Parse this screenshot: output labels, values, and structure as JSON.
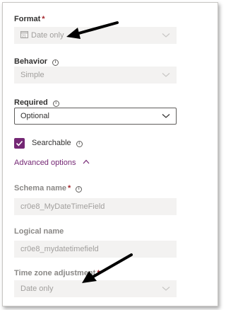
{
  "format": {
    "label": "Format",
    "required_mark": "*",
    "value": "Date only"
  },
  "behavior": {
    "label": "Behavior",
    "value": "Simple"
  },
  "required": {
    "label": "Required",
    "value": "Optional"
  },
  "searchable": {
    "label": "Searchable",
    "checked": true
  },
  "advanced_options": {
    "label": "Advanced options"
  },
  "schema_name": {
    "label": "Schema name",
    "required_mark": "*",
    "value": "cr0e8_MyDateTimeField"
  },
  "logical_name": {
    "label": "Logical name",
    "value": "cr0e8_mydatetimefield"
  },
  "time_zone": {
    "label": "Time zone adjustment",
    "required_mark": "*",
    "value": "Date only"
  },
  "colors": {
    "accent": "#742774",
    "required": "#a4262c",
    "disabled_field": "#f3f2f1",
    "arrow": "#000000"
  }
}
